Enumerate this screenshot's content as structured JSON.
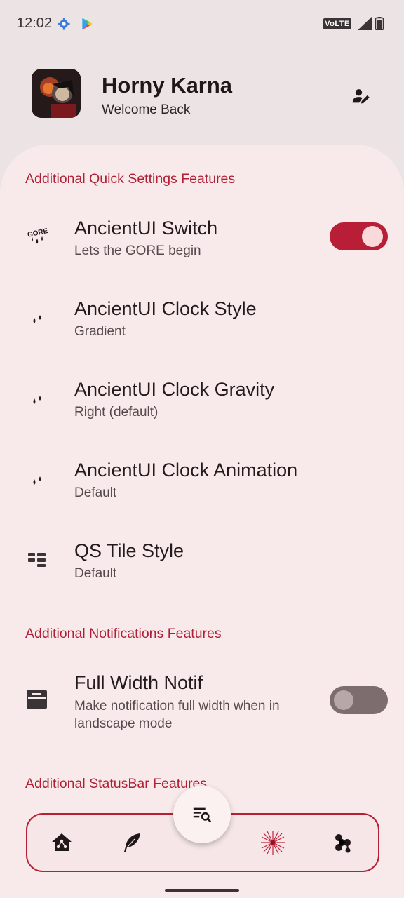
{
  "status_bar": {
    "time": "12:02",
    "network_badge": "VoLTE"
  },
  "header": {
    "user_name": "Horny Karna",
    "welcome": "Welcome Back"
  },
  "sections": [
    {
      "title": "Additional Quick Settings Features"
    },
    {
      "title": "Additional Notifications Features"
    },
    {
      "title": "Additional StatusBar Features"
    }
  ],
  "rows": [
    {
      "title": "AncientUI Switch",
      "subtitle": "Lets the GORE begin",
      "icon": "gore-drops-icon",
      "toggle": "on"
    },
    {
      "title": "AncientUI Clock Style",
      "subtitle": "Gradient",
      "icon": "drops-icon"
    },
    {
      "title": "AncientUI Clock Gravity",
      "subtitle": "Right (default)",
      "icon": "drops-icon"
    },
    {
      "title": "AncientUI Clock Animation",
      "subtitle": "Default",
      "icon": "drops-icon"
    },
    {
      "title": "QS Tile Style",
      "subtitle": "Default",
      "icon": "tiles-icon"
    },
    {
      "title": "Full Width Notif",
      "subtitle": "Make notification full width when in landscape mode",
      "icon": "notification-card-icon",
      "toggle": "off"
    }
  ],
  "icon_labels": {
    "gore": "GORE"
  },
  "bottom_nav": [
    "home-network-icon",
    "feather-icon",
    "search-list-icon",
    "burst-icon",
    "molecule-icon"
  ],
  "colors": {
    "accent": "#b01f35",
    "sheet": "#f8eaea",
    "background": "#ece4e4",
    "toggle_on": "#b81e36",
    "toggle_off": "#7d6d6f"
  }
}
